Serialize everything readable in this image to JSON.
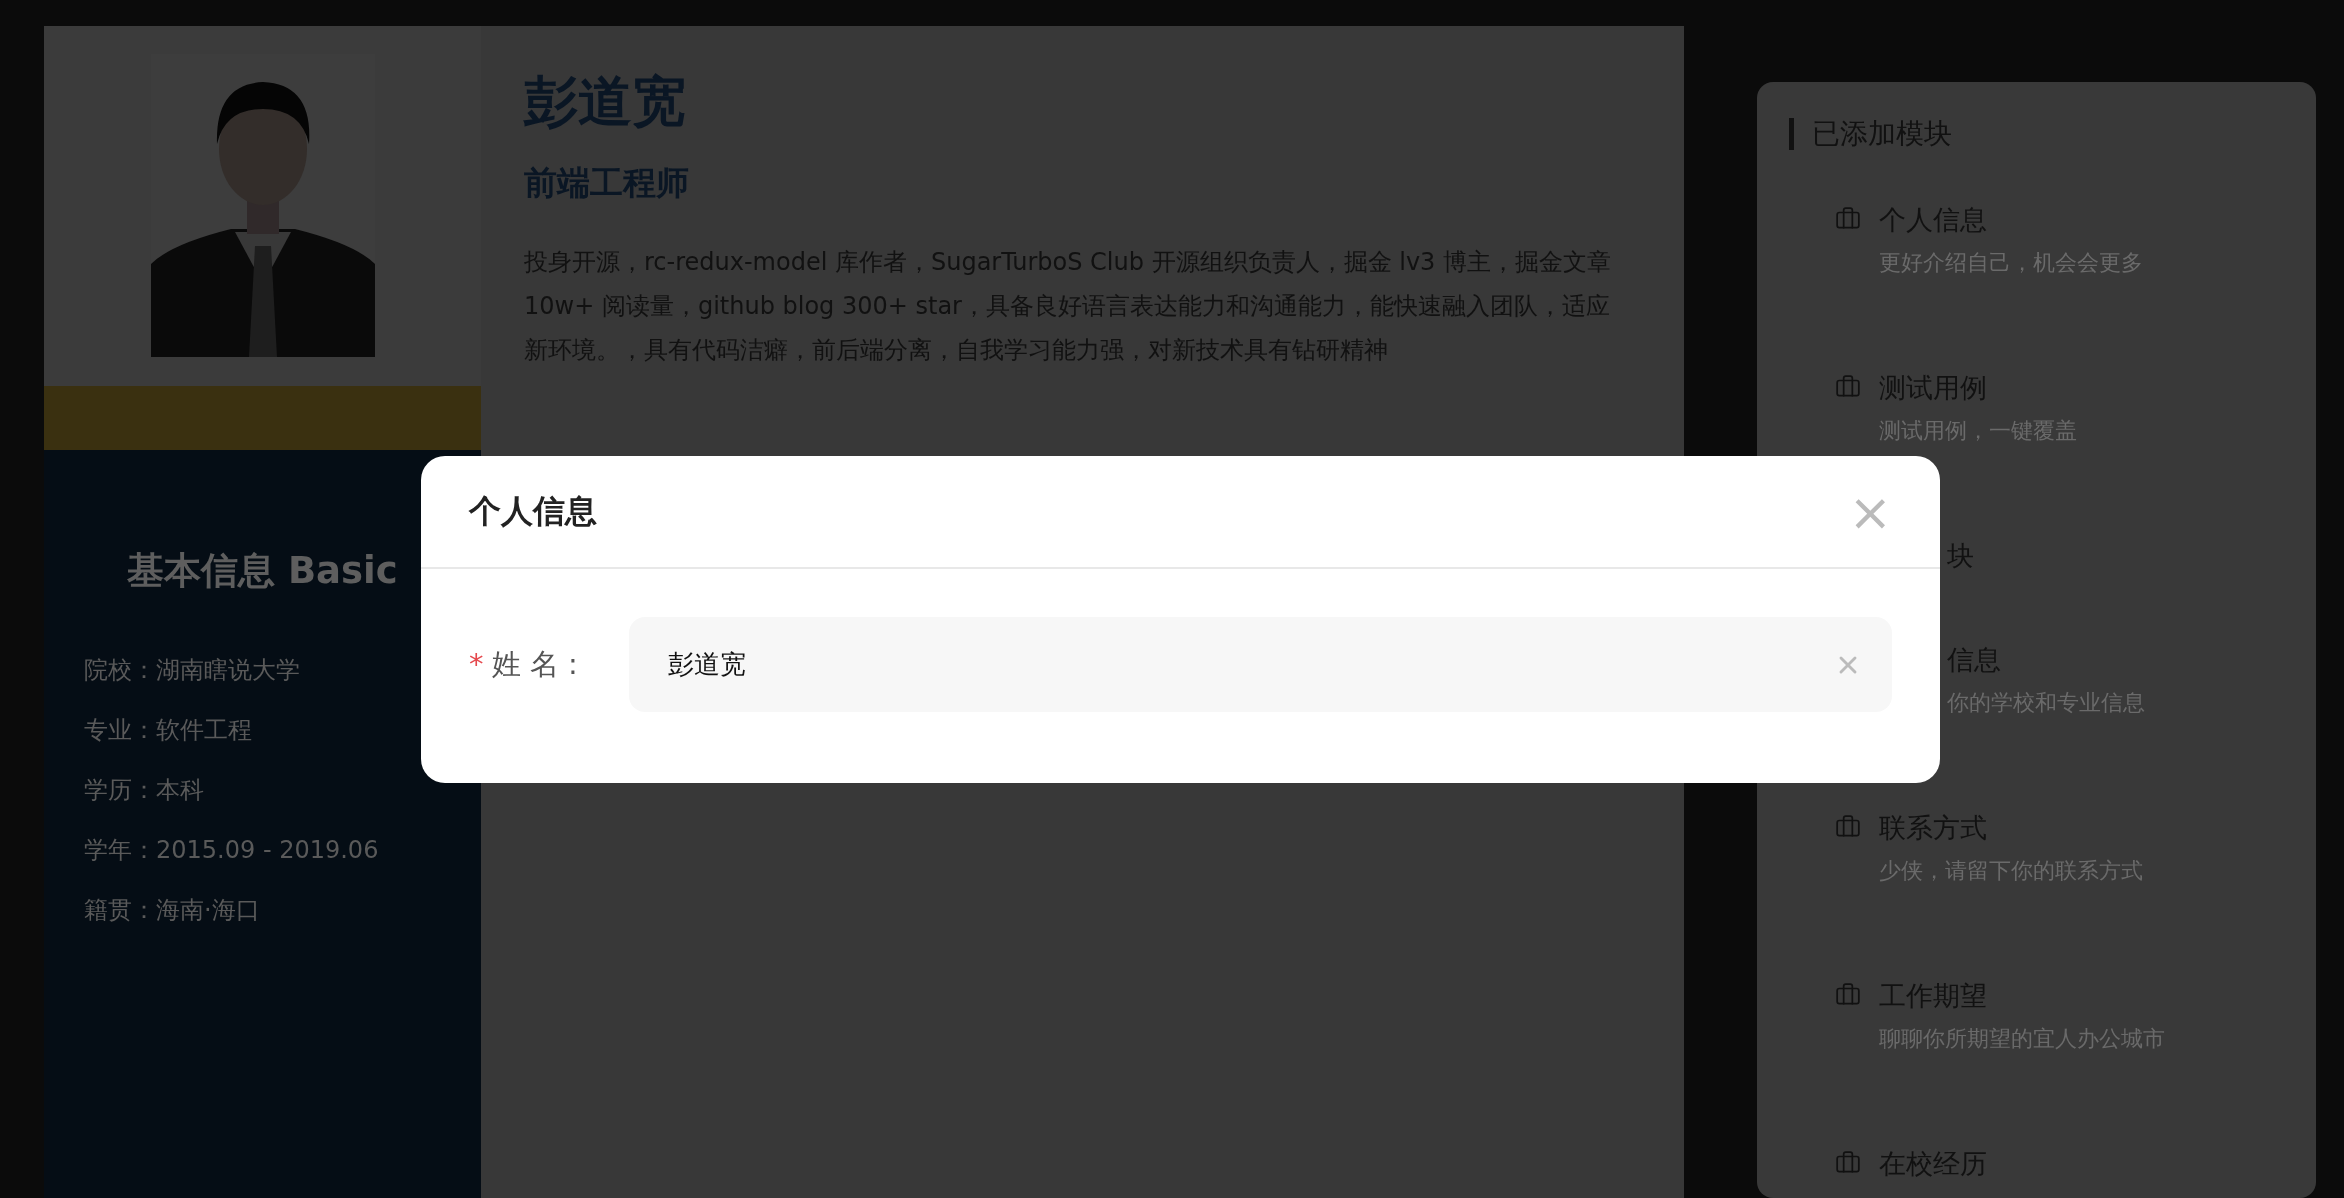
{
  "resume": {
    "sidebar": {
      "section_title": "基本信息 Basic",
      "facts": [
        {
          "label": "院校：",
          "value": "湖南瞎说大学"
        },
        {
          "label": "专业：",
          "value": "软件工程"
        },
        {
          "label": "学历：",
          "value": "本科"
        },
        {
          "label": "学年：",
          "value": "2015.09 - 2019.06"
        },
        {
          "label": "籍贯：",
          "value": "海南·海口"
        }
      ]
    },
    "name": "彭道宽",
    "job_title": "前端工程师",
    "summary": "投身开源，rc-redux-model 库作者，SugarTurboS Club 开源组织负责人，掘金 lv3 博主，掘金文章 10w+ 阅读量，github blog 300+ star，具备良好语言表达能力和沟通能力，能快速融入团队，适应新环境。，具有代码洁癖，前后端分离，自我学习能力强，对新技术具有钻研精神"
  },
  "module_panel": {
    "title": "已添加模块",
    "items": [
      {
        "kind": "module",
        "title": "个人信息",
        "subtitle": "更好介绍自己，机会会更多"
      },
      {
        "kind": "module",
        "title": "测试用例",
        "subtitle": "测试用例，一键覆盖"
      },
      {
        "kind": "heading_fragment",
        "title": "块"
      },
      {
        "kind": "module_fragment",
        "title": "信息",
        "subtitle": "你的学校和专业信息"
      },
      {
        "kind": "module",
        "title": "联系方式",
        "subtitle": "少侠，请留下你的联系方式"
      },
      {
        "kind": "module",
        "title": "工作期望",
        "subtitle": "聊聊你所期望的宜人办公城市"
      },
      {
        "kind": "module_title_only",
        "title": "在校经历"
      }
    ]
  },
  "dialog": {
    "title": "个人信息",
    "close": "×",
    "field": {
      "required_mark": "*",
      "label": "姓 名 :",
      "value": "彭道宽"
    }
  }
}
